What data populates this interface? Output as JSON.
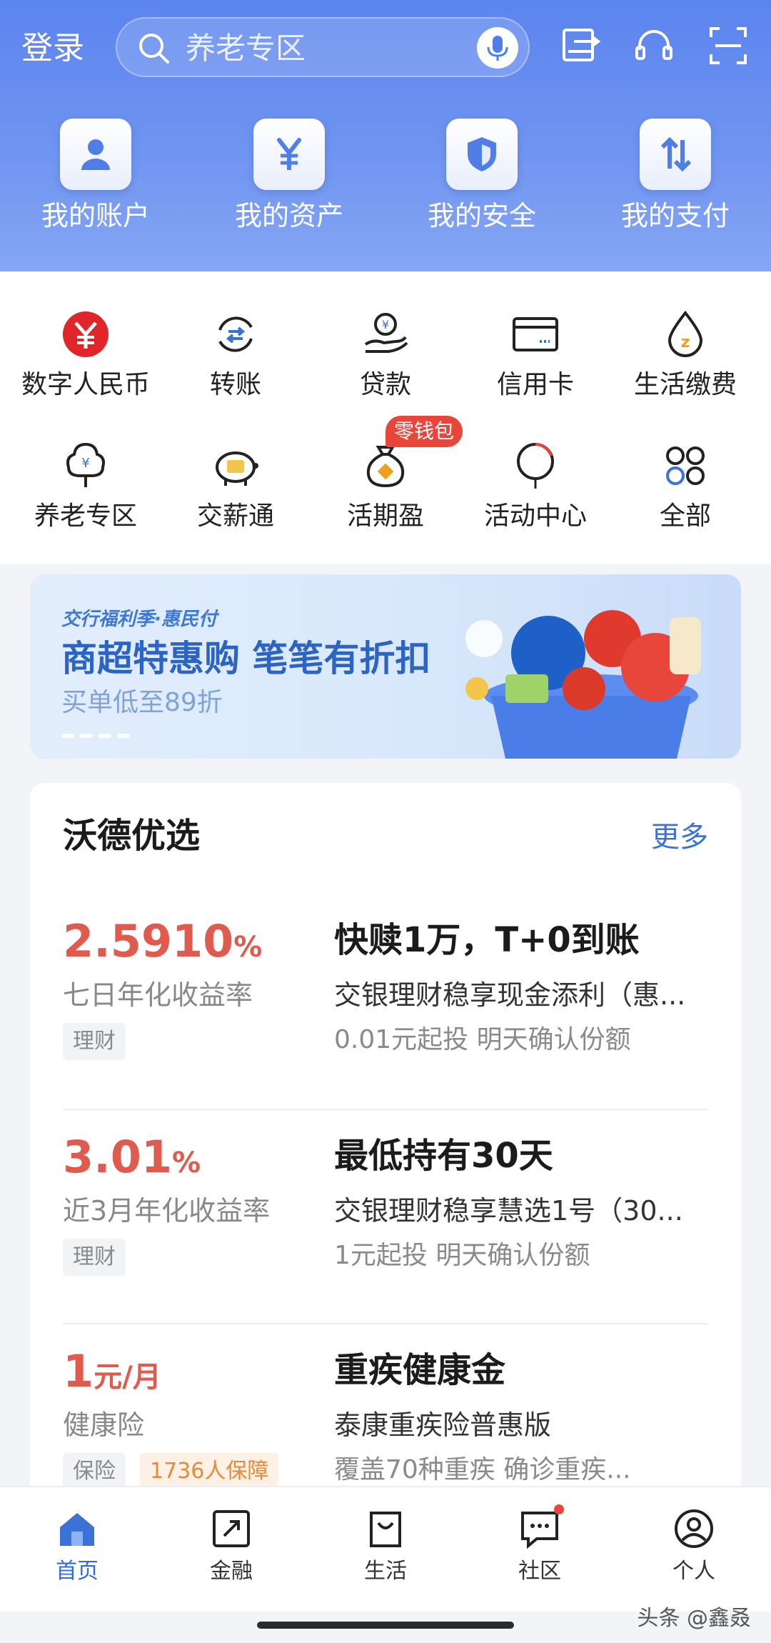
{
  "header": {
    "login_label": "登录",
    "search_placeholder": "养老专区",
    "quick_actions": [
      {
        "label": "我的账户",
        "icon": "person-icon"
      },
      {
        "label": "我的资产",
        "icon": "yen-icon"
      },
      {
        "label": "我的安全",
        "icon": "shield-icon"
      },
      {
        "label": "我的支付",
        "icon": "transfer-arrows-icon"
      }
    ],
    "top_icons": [
      "switch-icon",
      "headset-icon",
      "scan-icon"
    ]
  },
  "services": [
    {
      "label": "数字人民币",
      "icon": "digital-rmb-icon"
    },
    {
      "label": "转账",
      "icon": "transfer-icon"
    },
    {
      "label": "贷款",
      "icon": "loan-icon"
    },
    {
      "label": "信用卡",
      "icon": "credit-card-icon"
    },
    {
      "label": "生活缴费",
      "icon": "utility-payment-icon"
    },
    {
      "label": "养老专区",
      "icon": "pension-tree-icon"
    },
    {
      "label": "交薪通",
      "icon": "piggy-bank-icon"
    },
    {
      "label": "活期盈",
      "icon": "money-bag-icon"
    },
    {
      "label": "活动中心",
      "icon": "balloon-icon"
    },
    {
      "label": "全部",
      "icon": "grid-icon"
    }
  ],
  "services_badge": "零钱包",
  "banner": {
    "tag": "交行福利季·惠民付",
    "title": "商超特惠购 笔笔有折扣",
    "subtitle": "买单低至89折"
  },
  "card": {
    "title": "沃德优选",
    "more_label": "更多",
    "products": [
      {
        "rate": "2.5910",
        "rate_unit": "%",
        "rate_desc": "七日年化收益率",
        "tags": [
          "理财"
        ],
        "title": "快赎1万，T+0到账",
        "name": "交银理财稳享现金添利（惠...",
        "desc": "0.01元起投 明天确认份额"
      },
      {
        "rate": "3.01",
        "rate_unit": "%",
        "rate_desc": "近3月年化收益率",
        "tags": [
          "理财"
        ],
        "title": "最低持有30天",
        "name": "交银理财稳享慧选1号（30...",
        "desc": "1元起投 明天确认份额"
      },
      {
        "rate": "1",
        "rate_unit": "元/月",
        "rate_desc": "健康险",
        "tags": [
          "保险",
          "1736人保障"
        ],
        "title": "重疾健康金",
        "name": "泰康重疾险普惠版",
        "desc": "覆盖70种重疾 确诊重疾..."
      }
    ]
  },
  "tabbar": [
    {
      "label": "首页",
      "icon": "home-icon",
      "active": true
    },
    {
      "label": "金融",
      "icon": "finance-icon",
      "active": false
    },
    {
      "label": "生活",
      "icon": "shopping-bag-icon",
      "active": false
    },
    {
      "label": "社区",
      "icon": "chat-icon",
      "active": false
    },
    {
      "label": "个人",
      "icon": "profile-icon",
      "active": false
    }
  ],
  "watermark": "头条 @鑫叒",
  "colors": {
    "header_blue": "#5b84ee",
    "accent_blue": "#2f6ae0",
    "rate_red": "#e05a4e",
    "badge_red": "#e8463b"
  }
}
